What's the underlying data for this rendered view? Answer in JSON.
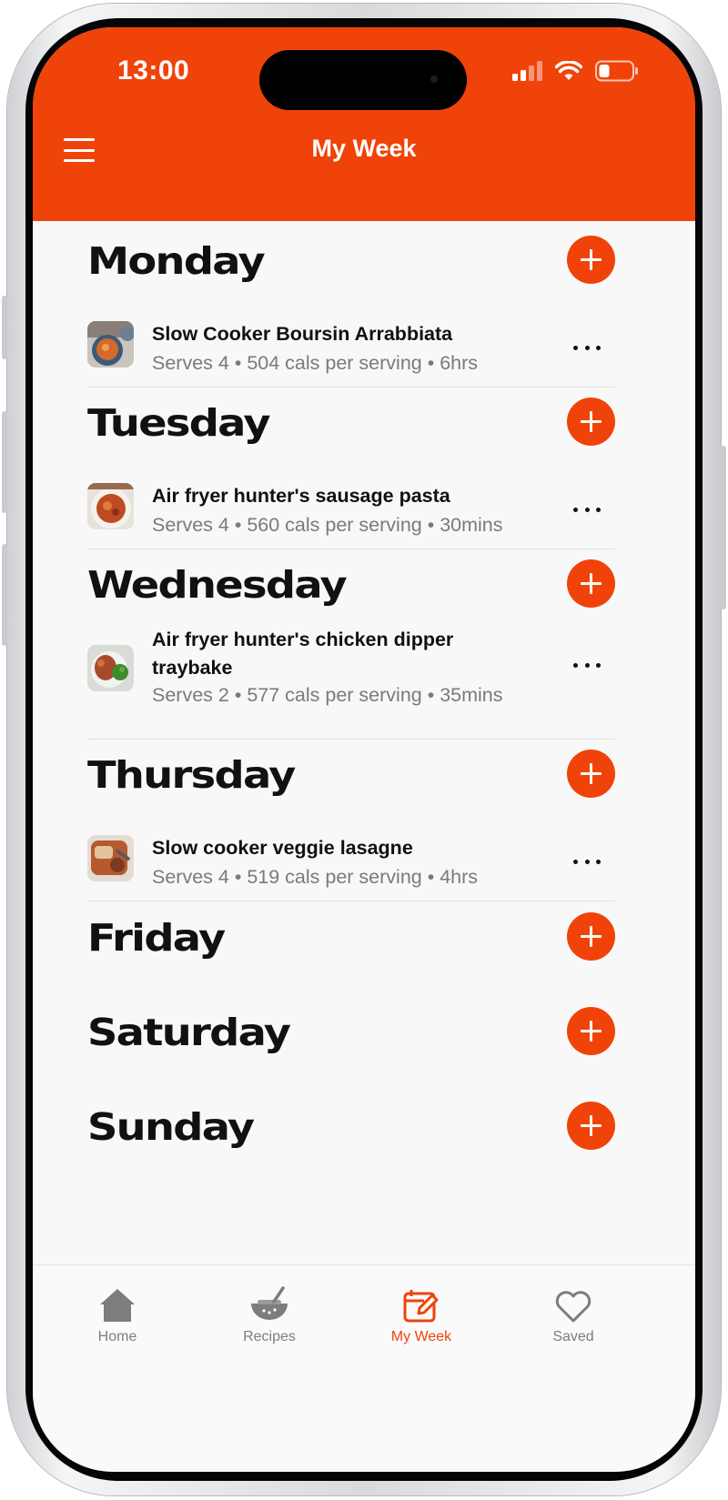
{
  "status_bar": {
    "time": "13:00"
  },
  "header": {
    "title": "My Week"
  },
  "days": [
    {
      "name": "Monday",
      "recipe": {
        "title": "Slow Cooker Boursin Arrabbiata",
        "meta": "Serves 4 • 504 cals per serving • 6hrs"
      }
    },
    {
      "name": "Tuesday",
      "recipe": {
        "title": "Air fryer hunter's sausage pasta",
        "meta": "Serves 4 • 560 cals per serving • 30mins"
      }
    },
    {
      "name": "Wednesday",
      "recipe": {
        "title": "Air fryer hunter's chicken dipper traybake",
        "meta": "Serves 2 • 577 cals per serving • 35mins"
      }
    },
    {
      "name": "Thursday",
      "recipe": {
        "title": "Slow cooker veggie lasagne",
        "meta": "Serves 4 • 519 cals per serving • 4hrs"
      }
    },
    {
      "name": "Friday"
    },
    {
      "name": "Saturday"
    },
    {
      "name": "Sunday"
    }
  ],
  "tabbar": {
    "items": [
      {
        "label": "Home",
        "icon": "home-icon"
      },
      {
        "label": "Recipes",
        "icon": "bowl-icon"
      },
      {
        "label": "My Week",
        "icon": "edit-calendar-icon",
        "active": true
      },
      {
        "label": "Saved",
        "icon": "heart-icon"
      }
    ]
  },
  "colors": {
    "accent": "#ef4309",
    "inactive_tab": "#7d7d7d",
    "background": "#f8f8f8"
  }
}
